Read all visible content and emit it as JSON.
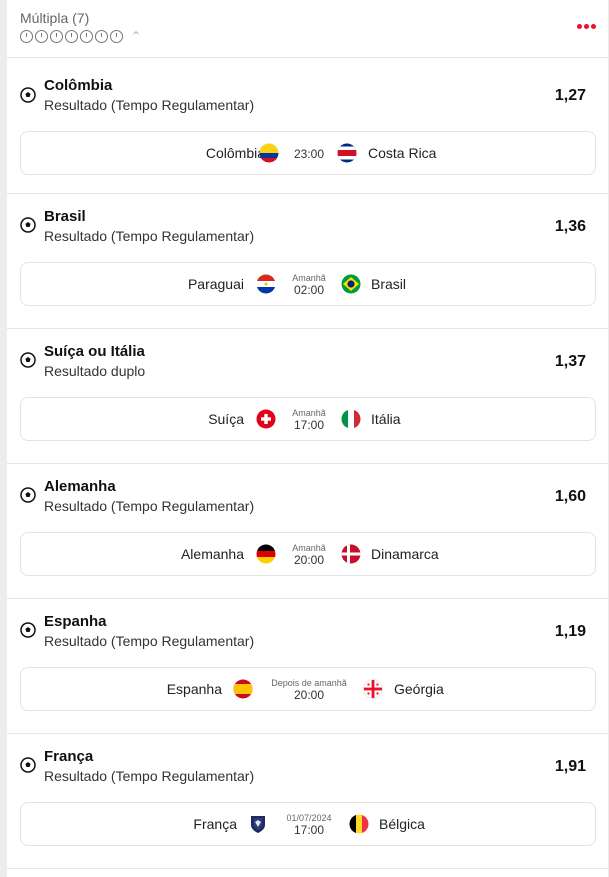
{
  "header": {
    "title": "Múltipla (7)",
    "clock_count": 7
  },
  "colors": {
    "accent": "#e8142b"
  },
  "selections": [
    {
      "name": "Colômbia",
      "market": "Resultado (Tempo Regulamentar)",
      "odd": "1,27",
      "match": {
        "home": "Colômbia",
        "away": "Costa Rica",
        "day": "",
        "time": "23:00"
      }
    },
    {
      "name": "Brasil",
      "market": "Resultado (Tempo Regulamentar)",
      "odd": "1,36",
      "match": {
        "home": "Paraguai",
        "away": "Brasil",
        "day": "Amanhã",
        "time": "02:00"
      }
    },
    {
      "name": "Suíça ou Itália",
      "market": "Resultado duplo",
      "odd": "1,37",
      "match": {
        "home": "Suíça",
        "away": "Itália",
        "day": "Amanhã",
        "time": "17:00"
      }
    },
    {
      "name": "Alemanha",
      "market": "Resultado (Tempo Regulamentar)",
      "odd": "1,60",
      "match": {
        "home": "Alemanha",
        "away": "Dinamarca",
        "day": "Amanhã",
        "time": "20:00"
      }
    },
    {
      "name": "Espanha",
      "market": "Resultado (Tempo Regulamentar)",
      "odd": "1,19",
      "match": {
        "home": "Espanha",
        "away": "Geórgia",
        "day": "Depois de amanhã",
        "time": "20:00"
      }
    },
    {
      "name": "França",
      "market": "Resultado (Tempo Regulamentar)",
      "odd": "1,91",
      "match": {
        "home": "França",
        "away": "Bélgica",
        "day": "01/07/2024",
        "time": "17:00"
      }
    }
  ]
}
